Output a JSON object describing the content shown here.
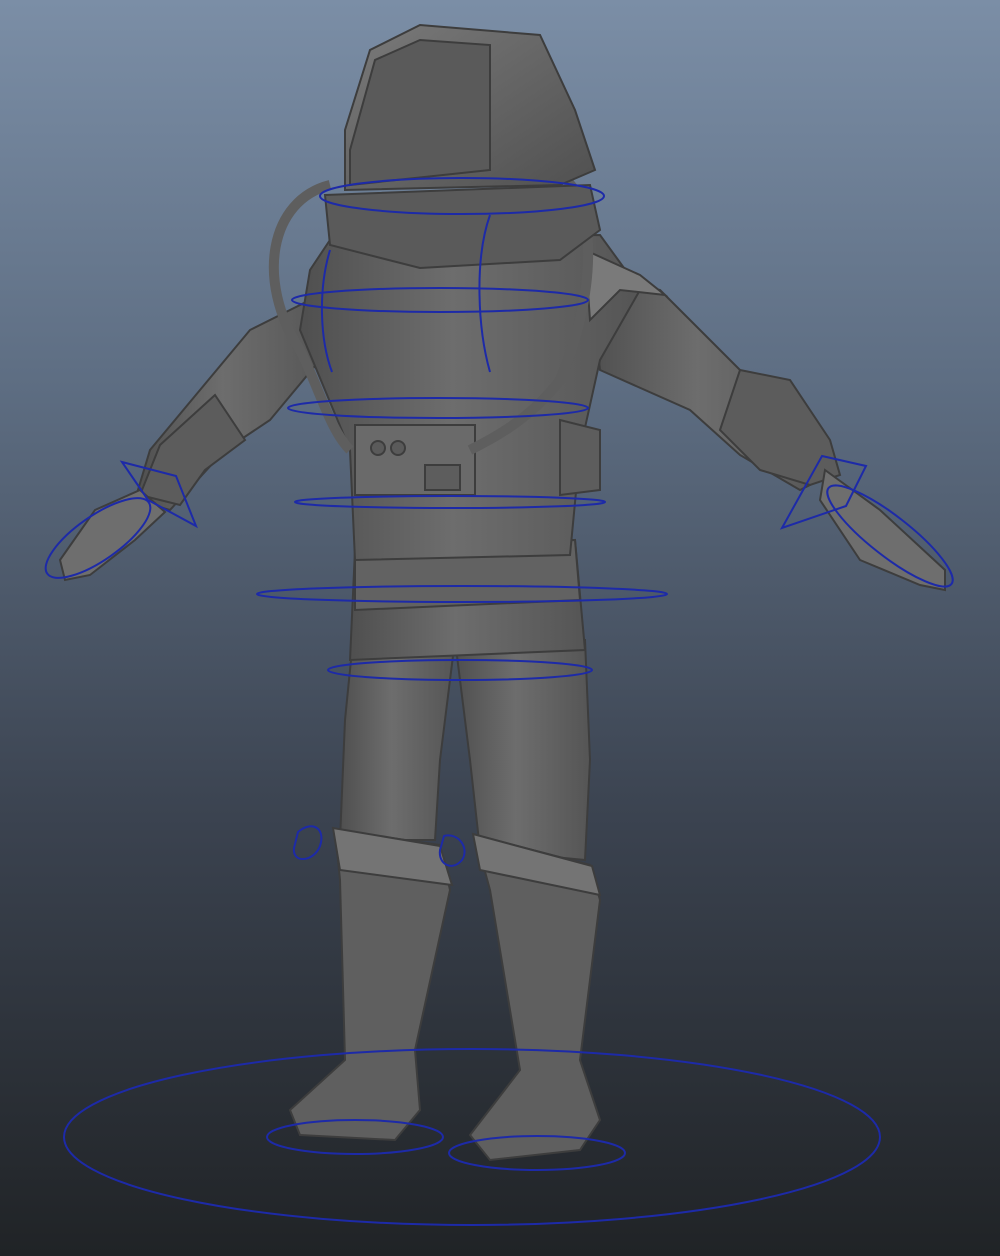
{
  "viewport": {
    "camera": "perspective",
    "background_top": "#7b8ea6",
    "background_bottom": "#202326"
  },
  "model": {
    "type": "character-mesh",
    "pose": "t-pose",
    "mesh_color": "#6a6a6a",
    "mesh_shadow": "#4e4e4e",
    "mesh_highlight": "#8a8a8a"
  },
  "rig": {
    "control_color": "#1d2aa8",
    "controls": [
      "root-control",
      "foot-control-left",
      "foot-control-right",
      "knee-pole-left",
      "knee-pole-right",
      "hips-control",
      "pelvis-control",
      "spine-control",
      "chest-control",
      "neck-control",
      "head-control",
      "wrist-control-left",
      "wrist-control-right",
      "hand-control-left",
      "hand-control-right"
    ]
  }
}
